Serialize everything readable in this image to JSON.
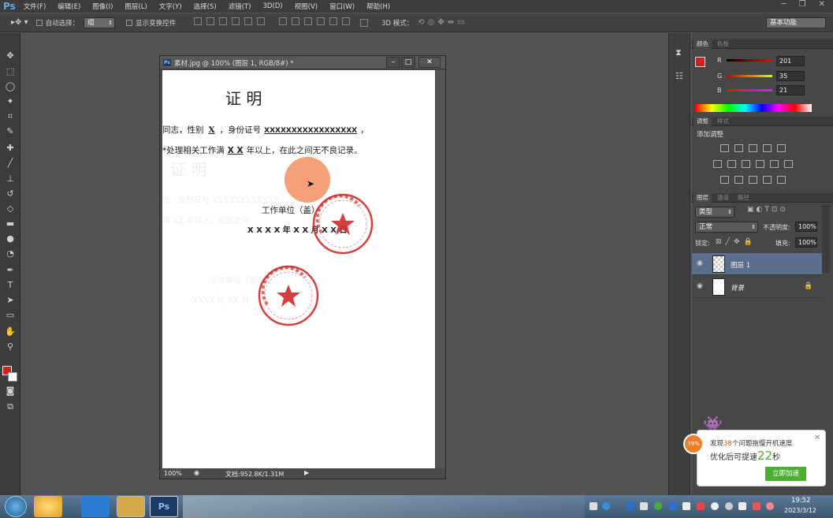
{
  "app": {
    "logo": "Ps"
  },
  "menu": [
    "文件(F)",
    "编辑(E)",
    "图像(I)",
    "图层(L)",
    "文字(Y)",
    "选择(S)",
    "滤镜(T)",
    "3D(D)",
    "视图(V)",
    "窗口(W)",
    "帮助(H)"
  ],
  "options": {
    "auto_select_label": "自动选择：",
    "auto_select_value": "组",
    "show_transform_label": "显示变换控件",
    "mode_3d_label": "3D 模式：",
    "workspace": "基本功能"
  },
  "document": {
    "title": "素材.jpg @ 100% (图层 1, RGB/8#) *",
    "zoom": "100%",
    "doc_size": "文档:952.8K/1.31M",
    "content": {
      "heading": "证    明",
      "line1_a": "同志，性别",
      "line1_gender": "X",
      "line1_b": "，身份证号",
      "line1_id": "XXXXXXXXXXXXXXXXX",
      "line1_end": "，",
      "line2_a": "*处理相关工作满",
      "line2_years": "X X",
      "line2_b": "年以上，在此之间无不良记录。",
      "ghost_heading": "证    明",
      "unit_label": "工作单位（盖",
      "unit_label_end": "）",
      "date_line": "X X X X  年 X X 月 X X 日",
      "ghost_line1": "志，身份证号  XXXXXXXXXXXX",
      "ghost_line2": "满  XX  年以上，在此之间",
      "ghost_unit": "工作单位（盖章）",
      "ghost_date": "XXXX 年 XX 月"
    }
  },
  "color_panel": {
    "tabs": [
      "颜色",
      "色板"
    ],
    "r_label": "R",
    "g_label": "G",
    "b_label": "B",
    "r": "201",
    "g": "35",
    "b": "21",
    "fg_color": "#c9231d"
  },
  "adjust_panel": {
    "tabs": [
      "调整",
      "样式"
    ],
    "title": "添加调整"
  },
  "layers_panel": {
    "tabs": [
      "图层",
      "通道",
      "路径"
    ],
    "filter_kind": "类型",
    "blend_mode": "正常",
    "opacity_label": "不透明度:",
    "opacity": "100%",
    "lock_label": "锁定:",
    "fill_label": "填充:",
    "fill": "100%",
    "layers": [
      {
        "name": "图层 1"
      },
      {
        "name": "背景"
      }
    ]
  },
  "notification": {
    "badge": "79%",
    "text1_a": "发现",
    "text1_num": "38",
    "text1_b": "个问题拖慢开机速度",
    "text2_a": "优化后可提速",
    "text2_num": "22",
    "text2_b": "秒",
    "button": "立即加速"
  },
  "taskbar": {
    "time": "19:52",
    "date": "2023/3/12"
  }
}
